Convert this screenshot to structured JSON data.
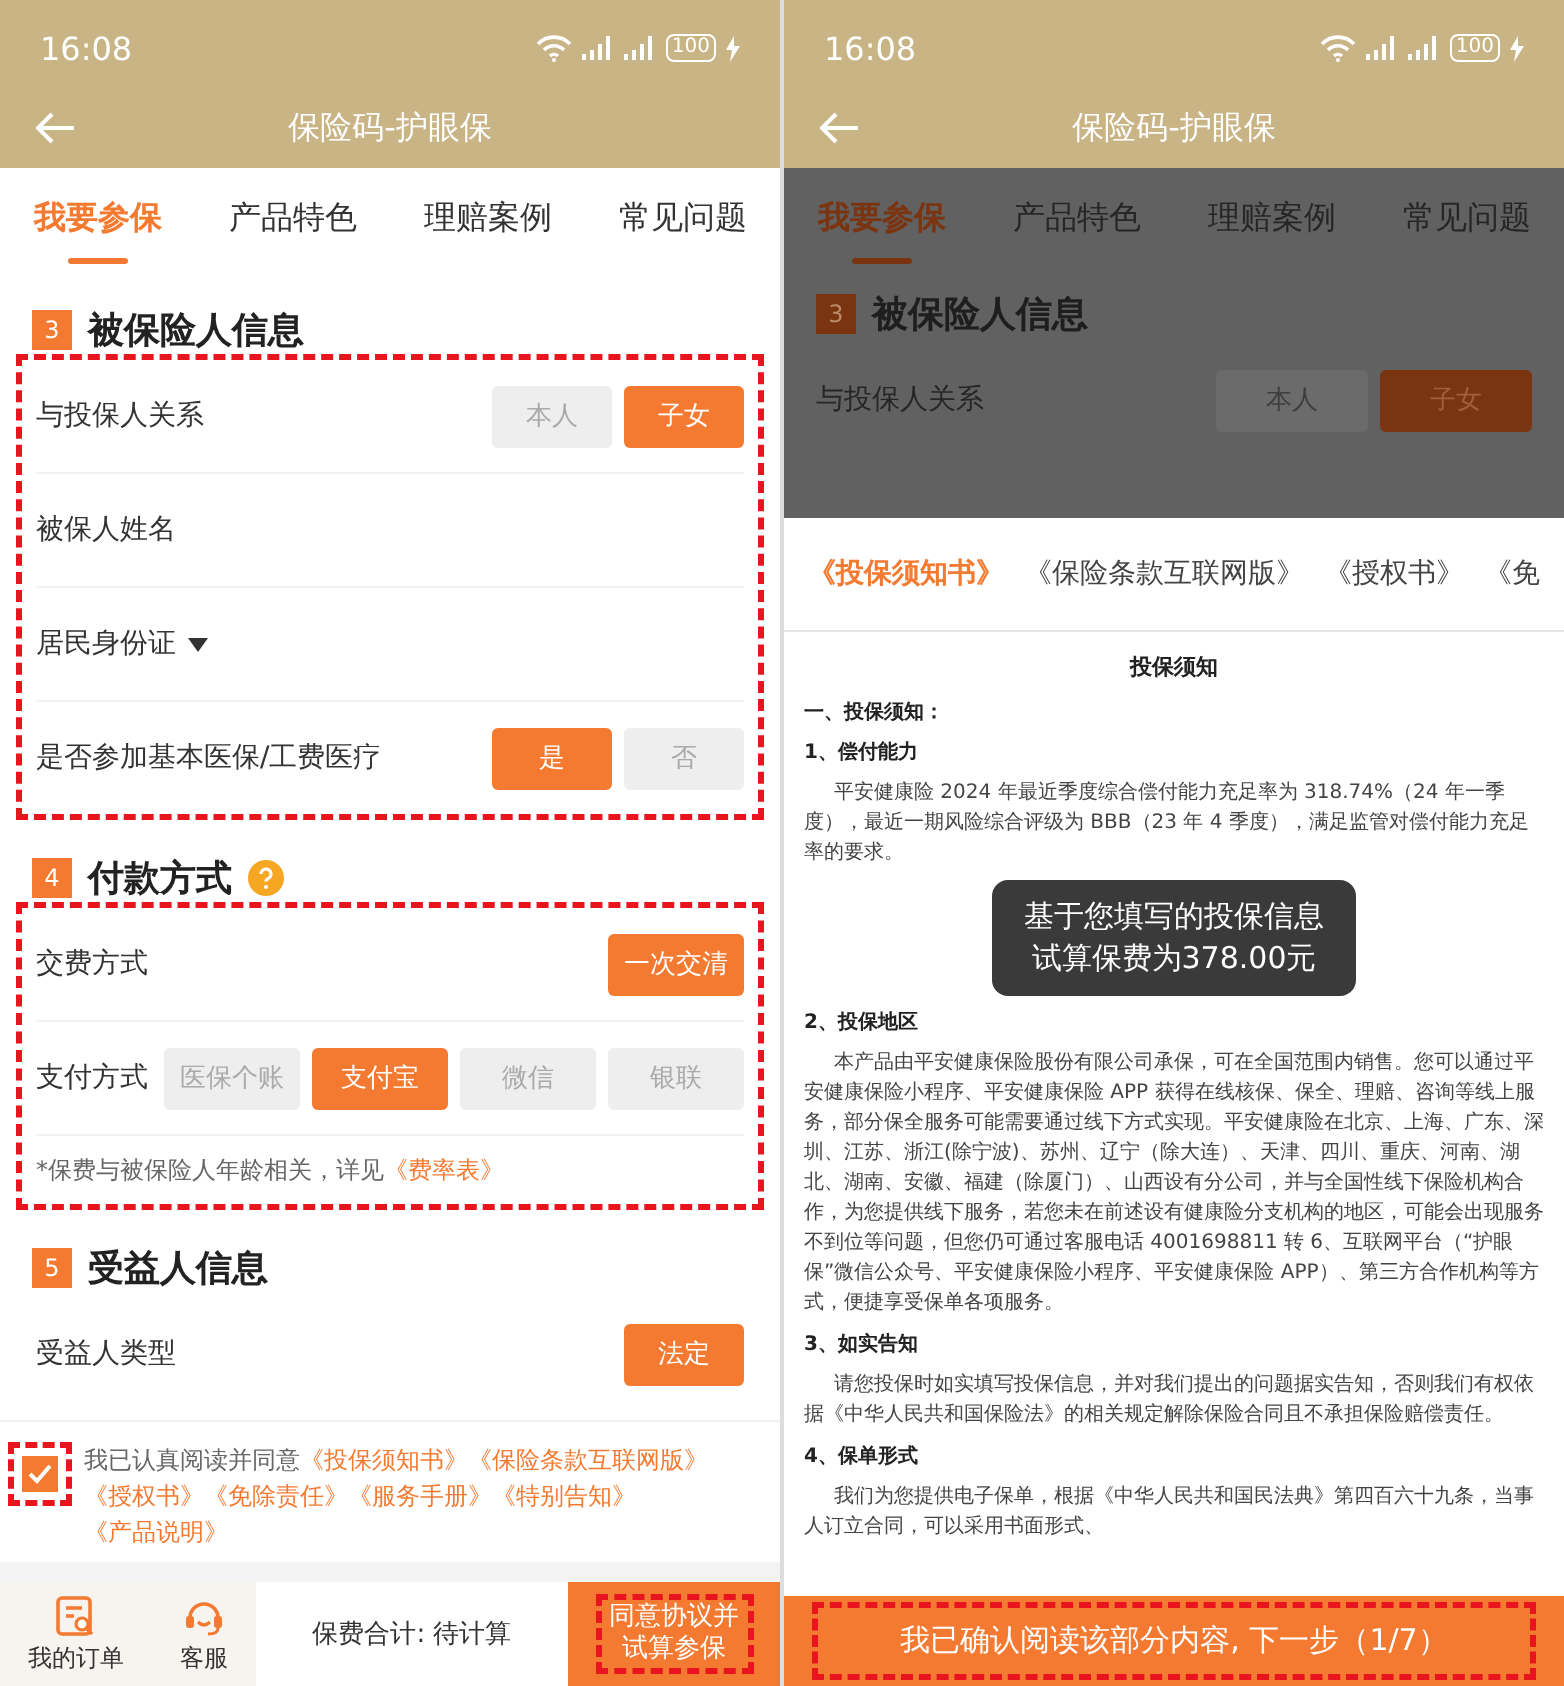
{
  "form_screen": {
    "status_bar": {
      "time": "16:08",
      "battery": "100"
    },
    "title": "保险码-护眼保",
    "tabs": [
      {
        "label": "我要参保",
        "selected": true
      },
      {
        "label": "产品特色",
        "selected": false
      },
      {
        "label": "理赔案例",
        "selected": false
      },
      {
        "label": "常见问题",
        "selected": false
      }
    ],
    "sections": [
      {
        "number": "3",
        "title": "被保险人信息",
        "annotated": true,
        "rows": [
          {
            "kind": "choice",
            "label": "与投保人关系",
            "options": [
              {
                "label": "本人",
                "selected": false
              },
              {
                "label": "子女",
                "selected": true
              }
            ]
          },
          {
            "kind": "input",
            "label": "被保人姓名"
          },
          {
            "kind": "dropdown",
            "label": "居民身份证"
          },
          {
            "kind": "choice",
            "label": "是否参加基本医保/工费医疗",
            "options": [
              {
                "label": "是",
                "selected": true
              },
              {
                "label": "否",
                "selected": false
              }
            ]
          }
        ]
      },
      {
        "number": "4",
        "title": "付款方式",
        "help": true,
        "annotated": true,
        "rows": [
          {
            "kind": "choice",
            "label": "交费方式",
            "options": [
              {
                "label": "一次交清",
                "selected": true
              }
            ]
          },
          {
            "kind": "segmented",
            "label": "支付方式",
            "options": [
              {
                "label": "医保个账",
                "selected": false
              },
              {
                "label": "支付宝",
                "selected": true
              },
              {
                "label": "微信",
                "selected": false
              },
              {
                "label": "银联",
                "selected": false
              }
            ]
          },
          {
            "kind": "note",
            "text": "*保费与被保险人年龄相关，详见",
            "link": "《费率表》"
          }
        ]
      },
      {
        "number": "5",
        "title": "受益人信息",
        "rows": [
          {
            "kind": "choice",
            "label": "受益人类型",
            "options": [
              {
                "label": "法定",
                "selected": true
              }
            ]
          }
        ]
      }
    ],
    "agreement": {
      "checked": true,
      "text": "我已认真阅读并同意",
      "links": [
        "《投保须知书》",
        "《保险条款互联网版》",
        "《授权书》",
        "《免除责任》",
        "《服务手册》",
        "《特别告知》",
        "《产品说明》"
      ]
    },
    "bottom_bar": {
      "actions": [
        {
          "kind": "order",
          "label": "我的订单"
        },
        {
          "kind": "service",
          "label": "客服"
        }
      ],
      "total": "保费合计: 待计算",
      "submit": "同意协议并试算参保"
    }
  },
  "document_screen": {
    "status_bar": {
      "time": "16:08",
      "battery": "100"
    },
    "title": "保险码-护眼保",
    "dimmed_page": {
      "tabs": [
        {
          "label": "我要参保",
          "selected": true
        },
        {
          "label": "产品特色",
          "selected": false
        },
        {
          "label": "理赔案例",
          "selected": false
        },
        {
          "label": "常见问题",
          "selected": false
        }
      ],
      "section": {
        "number": "3",
        "title": "被保险人信息"
      },
      "row": {
        "label": "与投保人关系",
        "options": [
          {
            "label": "本人",
            "selected": false
          },
          {
            "label": "子女",
            "selected": true
          }
        ]
      }
    },
    "doc_tabs": [
      {
        "label": "《投保须知书》",
        "selected": true
      },
      {
        "label": "《保险条款互联网版》",
        "selected": false
      },
      {
        "label": "《授权书》",
        "selected": false
      },
      {
        "label": "《免",
        "selected": false
      }
    ],
    "document": {
      "title": "投保须知",
      "blocks": [
        {
          "kind": "heading",
          "text": "一、投保须知："
        },
        {
          "kind": "heading",
          "text": "1、偿付能力"
        },
        {
          "kind": "paragraph",
          "text": "平安健康险 2024 年最近季度综合偿付能力充足率为 318.74%（24 年一季度），最近一期风险综合评级为 BBB（23 年 4 季度），满足监管对偿付能力充足率的要求。"
        },
        {
          "kind": "toast",
          "lines": [
            "基于您填写的投保信息",
            "试算保费为378.00元"
          ]
        },
        {
          "kind": "heading",
          "text": "2、投保地区"
        },
        {
          "kind": "paragraph",
          "text": "本产品由平安健康保险股份有限公司承保，可在全国范围内销售。您可以通过平安健康保险小程序、平安健康保险 APP 获得在线核保、保全、理赔、咨询等线上服务，部分保全服务可能需要通过线下方式实现。平安健康险在北京、上海、广东、深圳、江苏、浙江(除宁波)、苏州、辽宁（除大连）、天津、四川、重庆、河南、湖北、湖南、安徽、福建（除厦门）、山西设有分公司，并与全国性线下保险机构合作，为您提供线下服务，若您未在前述设有健康险分支机构的地区，可能会出现服务不到位等问题，但您仍可通过客服电话 4001698811 转 6、互联网平台（“护眼保”微信公众号、平安健康保险小程序、平安健康保险 APP）、第三方合作机构等方式，便捷享受保单各项服务。"
        },
        {
          "kind": "heading",
          "text": "3、如实告知"
        },
        {
          "kind": "paragraph",
          "text": "请您投保时如实填写投保信息，并对我们提出的问题据实告知，否则我们有权依据《中华人民共和国保险法》的相关规定解除保险合同且不承担保险赔偿责任。"
        },
        {
          "kind": "heading",
          "text": "4、保单形式"
        },
        {
          "kind": "paragraph",
          "text": "我们为您提供电子保单，根据《中华人民共和国民法典》第四百六十九条，当事人订立合同，可以采用书面形式、"
        }
      ]
    },
    "confirm_button": "我已确认阅读该部分内容, 下一步（1/7）"
  }
}
